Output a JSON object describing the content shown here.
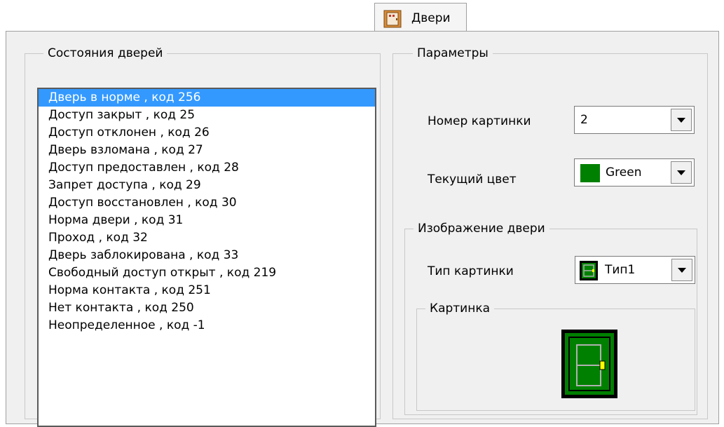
{
  "tab": {
    "label": "Двери",
    "icon": "door-icon"
  },
  "states_group": {
    "title": "Состояния дверей",
    "selected_index": 0,
    "items": [
      "Дверь в норме , код 256",
      "Доступ закрыт , код 25",
      "Доступ отклонен , код 26",
      "Дверь взломана , код 27",
      "Доступ предоставлен , код 28",
      "Запрет доступа , код 29",
      "Доступ восстановлен , код 30",
      "Норма двери , код 31",
      "Проход , код 32",
      "Дверь заблокирована , код 33",
      "Свободный доступ открыт , код 219",
      "Норма контакта , код 251",
      "Нет контакта , код 250",
      "Неопределенное , код -1"
    ]
  },
  "params_group": {
    "title": "Параметры",
    "picture_number": {
      "label": "Номер картинки",
      "value": "2"
    },
    "current_color": {
      "label": "Текущий цвет",
      "value": "Green",
      "swatch": "#008000"
    },
    "door_image_group": {
      "title": "Изображение двери",
      "picture_type": {
        "label": "Тип картинки",
        "value": "Тип1",
        "icon": "door-type-icon"
      },
      "picture_group": {
        "title": "Картинка",
        "icon": "door-picture-icon"
      }
    }
  },
  "colors": {
    "selection": "#3399ff",
    "door_green": "#008000",
    "door_frame": "#000000",
    "door_lines": "#b0b0b0",
    "door_handle": "#ffff00"
  }
}
